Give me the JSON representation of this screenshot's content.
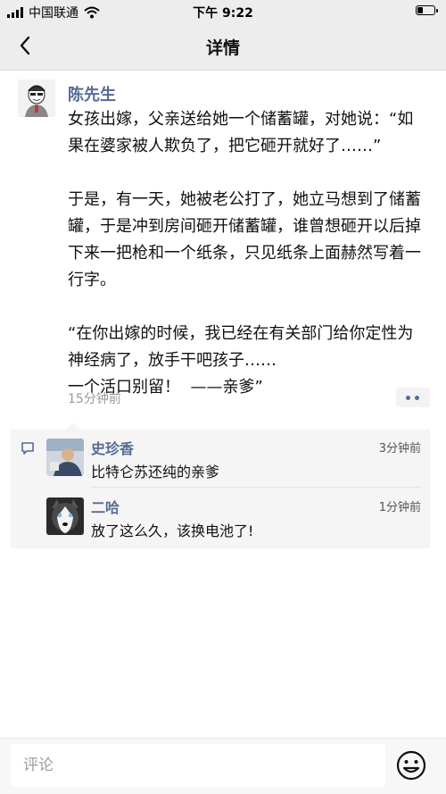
{
  "status_bar": {
    "carrier": "中国联通",
    "time": "下午 9:22",
    "icons": [
      "signal-icon",
      "wifi-icon",
      "battery-icon"
    ]
  },
  "nav": {
    "title": "详情",
    "back_icon": "chevron-left-icon"
  },
  "post": {
    "author": "陈先生",
    "content": "女孩出嫁，父亲送给她一个储蓄罐，对她说：“如果在婆家被人欺负了，把它砸开就好了……”\n\n于是，有一天，她被老公打了，她立马想到了储蓄罐，于是冲到房间砸开储蓄罐，谁曾想砸开以后掉下来一把枪和一个纸条，只见纸条上面赫然写着一行字。\n\n“在你出嫁的时候，我已经在有关部门给你定性为神经病了，放手干吧孩子……\n一个活口别留！  ——亲爹”",
    "time": "15分钟前",
    "more_icon": "more-dots-icon"
  },
  "comments": [
    {
      "name": "史珍香",
      "time": "3分钟前",
      "text": "比特仑苏还纯的亲爹"
    },
    {
      "name": "二哈",
      "time": "1分钟前",
      "text": "放了这么久，该换电池了!"
    }
  ],
  "bottom_bar": {
    "placeholder": "评论",
    "emoji_icon": "smiley-icon"
  },
  "colors": {
    "link_blue": "#576b95",
    "bar_gray": "#ededed",
    "comment_bg": "#f5f5f5",
    "muted_text": "#9a9a9a"
  }
}
